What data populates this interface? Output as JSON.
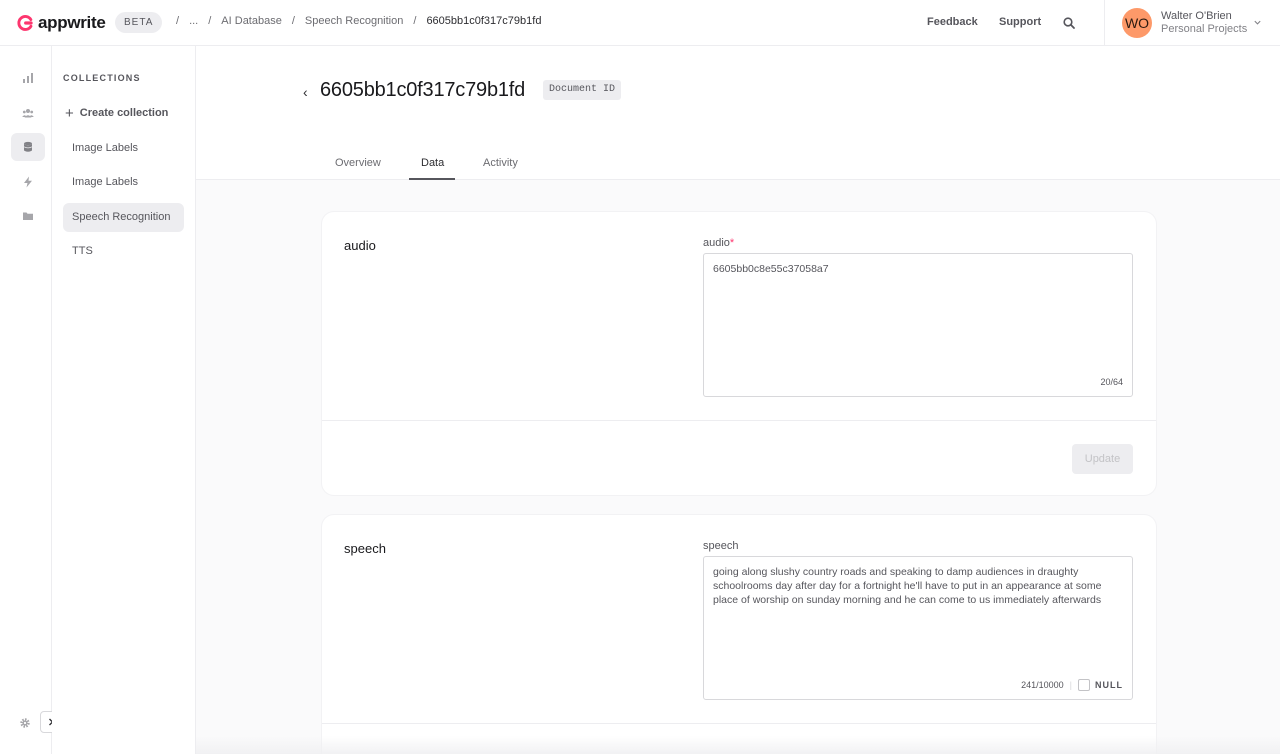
{
  "brand": {
    "name": "appwrite",
    "badge": "BETA",
    "accent": "#fd366e"
  },
  "breadcrumbs": [
    "...",
    "AI Database",
    "Speech Recognition",
    "6605bb1c0f317c79b1fd"
  ],
  "header": {
    "feedback": "Feedback",
    "support": "Support",
    "user": {
      "initials": "WO",
      "name": "Walter O'Brien",
      "org": "Personal Projects",
      "avatar_color": "#fd9969"
    }
  },
  "rail": {
    "items": [
      "chart-bar-icon",
      "users-icon",
      "database-icon",
      "lightning-icon",
      "folder-icon"
    ],
    "active": "database-icon",
    "bottom": [
      "settings-icon",
      "chevron-right-icon"
    ]
  },
  "collections": {
    "title": "COLLECTIONS",
    "create_label": "Create collection",
    "items": [
      "Image Labels",
      "Image Labels",
      "Speech Recognition",
      "TTS"
    ],
    "active": "Speech Recognition"
  },
  "document": {
    "title": "6605bb1c0f317c79b1fd",
    "badge": "Document ID",
    "tabs": [
      "Overview",
      "Data",
      "Activity"
    ],
    "active_tab": "Data"
  },
  "attributes": [
    {
      "name": "audio",
      "label": "audio",
      "required": true,
      "required_mark": "*",
      "value": "6605bb0c8e55c37058a7",
      "counter": "20/64",
      "update_label": "Update"
    },
    {
      "name": "speech",
      "label": "speech",
      "required": false,
      "value": " going along slushy country roads and speaking to damp audiences in draughty schoolrooms day after day for a fortnight he'll have to put in an appearance at some place of worship on sunday morning and he can come to us immediately afterwards",
      "counter": "241/10000",
      "null_label": "NULL"
    }
  ]
}
